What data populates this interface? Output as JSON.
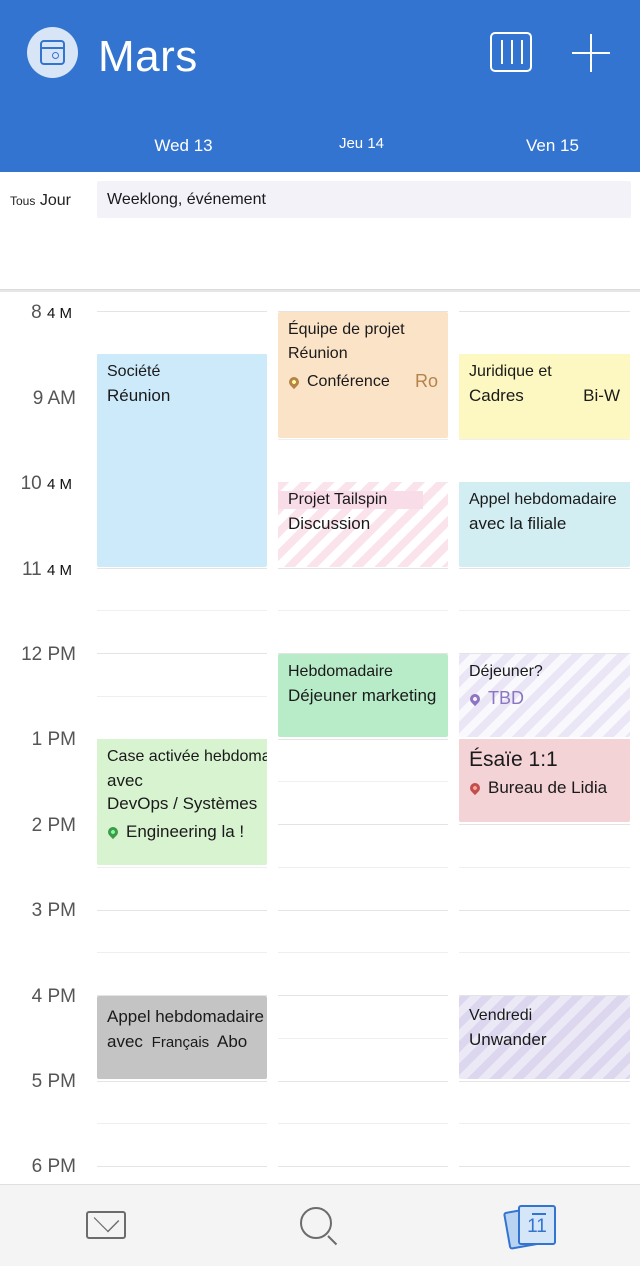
{
  "header": {
    "title": "Mars",
    "days": [
      "Wed 13",
      "Jeu 14",
      "Ven 15"
    ]
  },
  "allday": {
    "label_small": "Tous",
    "label": "Jour",
    "event": "Weeklong, événement"
  },
  "times": [
    {
      "main": "8",
      "suffix": "4 M"
    },
    {
      "main": "9 AM",
      "suffix": ""
    },
    {
      "main": "10",
      "suffix": "4 M"
    },
    {
      "main": "11",
      "suffix": "4 M"
    },
    {
      "main": "12 PM",
      "suffix": ""
    },
    {
      "main": "1 PM",
      "suffix": ""
    },
    {
      "main": "2 PM",
      "suffix": ""
    },
    {
      "main": "3 PM",
      "suffix": ""
    },
    {
      "main": "4 PM",
      "suffix": ""
    },
    {
      "main": "5 PM",
      "suffix": ""
    },
    {
      "main": "6 PM",
      "suffix": ""
    }
  ],
  "events": {
    "societe": {
      "line1": "Société",
      "line2": "Réunion"
    },
    "equipe": {
      "line1": "Équipe de projet",
      "line1b": "Réunion",
      "location": "Conférence",
      "location_tail": "Ro"
    },
    "juridique": {
      "line1": "Juridique et",
      "line2": "Cadres",
      "line2_tail": "Bi-W"
    },
    "tailspin": {
      "line1": "Projet Tailspin",
      "line2": "Discussion"
    },
    "appel_filiale": {
      "line1": "Appel hebdomadaire",
      "line2": "avec la filiale"
    },
    "dejeuner_marketing": {
      "line1": "Hebdomadaire",
      "line2": "Déjeuner marketing"
    },
    "dejeuner": {
      "line1": "Déjeuner?",
      "location": "TBD"
    },
    "devops": {
      "line1": "Case activée hebdomadaire",
      "line2": "avec",
      "line3": "DevOps / Systèmes",
      "location": "Engineering la !"
    },
    "esaie": {
      "line1": "Ésaïe 1:1",
      "location": "Bureau de Lidia"
    },
    "appel_francais": {
      "line1": "Appel hebdomadaire",
      "line2a": "avec",
      "line2b": "Français",
      "line2c": "Abo"
    },
    "vendredi": {
      "line1": "Vendredi",
      "line2": "Unwander"
    }
  },
  "colors": {
    "header": "#3274d0",
    "blue_event": "#cdeafb",
    "orange_event": "#fbe3c8",
    "yellow_event": "#fdf8c2",
    "teal_event": "#d2eef2",
    "green_event": "#b8ecc9",
    "lightgreen_event": "#d8f3d0",
    "red_event": "#f3d3d6",
    "gray_event": "#c4c4c4"
  },
  "tabs": {
    "mail": "mail-icon",
    "search": "search-icon",
    "calendar": "calendar-icon",
    "calendar_day": "11"
  }
}
